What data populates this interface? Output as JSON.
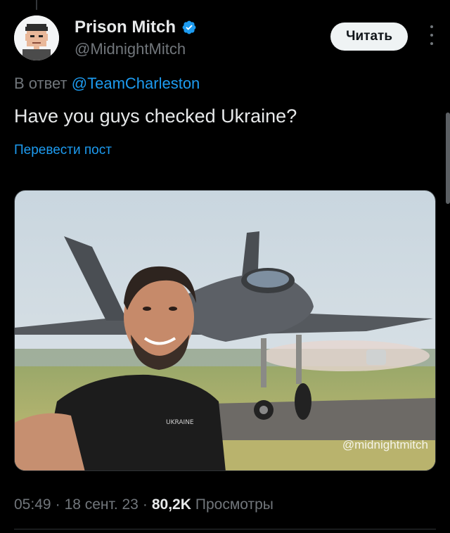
{
  "author": {
    "display_name": "Prison Mitch",
    "handle": "@MidnightMitch",
    "verified_icon": "verified-badge-icon",
    "verified_color": "#1d9bf0"
  },
  "actions": {
    "follow_label": "Читать",
    "more_icon": "more-options-icon"
  },
  "tweet": {
    "reply_prefix": "В ответ",
    "reply_mention": "@TeamCharleston",
    "text": "Have you guys checked Ukraine?",
    "translate_label": "Перевести пост",
    "media_watermark": "@midnightmitch",
    "shirt_text": "UKRAINE"
  },
  "meta": {
    "time": "05:49",
    "date": "18 сент. 23",
    "separator": "·",
    "views_count": "80,2K",
    "views_label": "Просмотры"
  },
  "colors": {
    "background": "#000000",
    "text": "#e7e9ea",
    "muted": "#71767b",
    "accent": "#1d9bf0"
  }
}
